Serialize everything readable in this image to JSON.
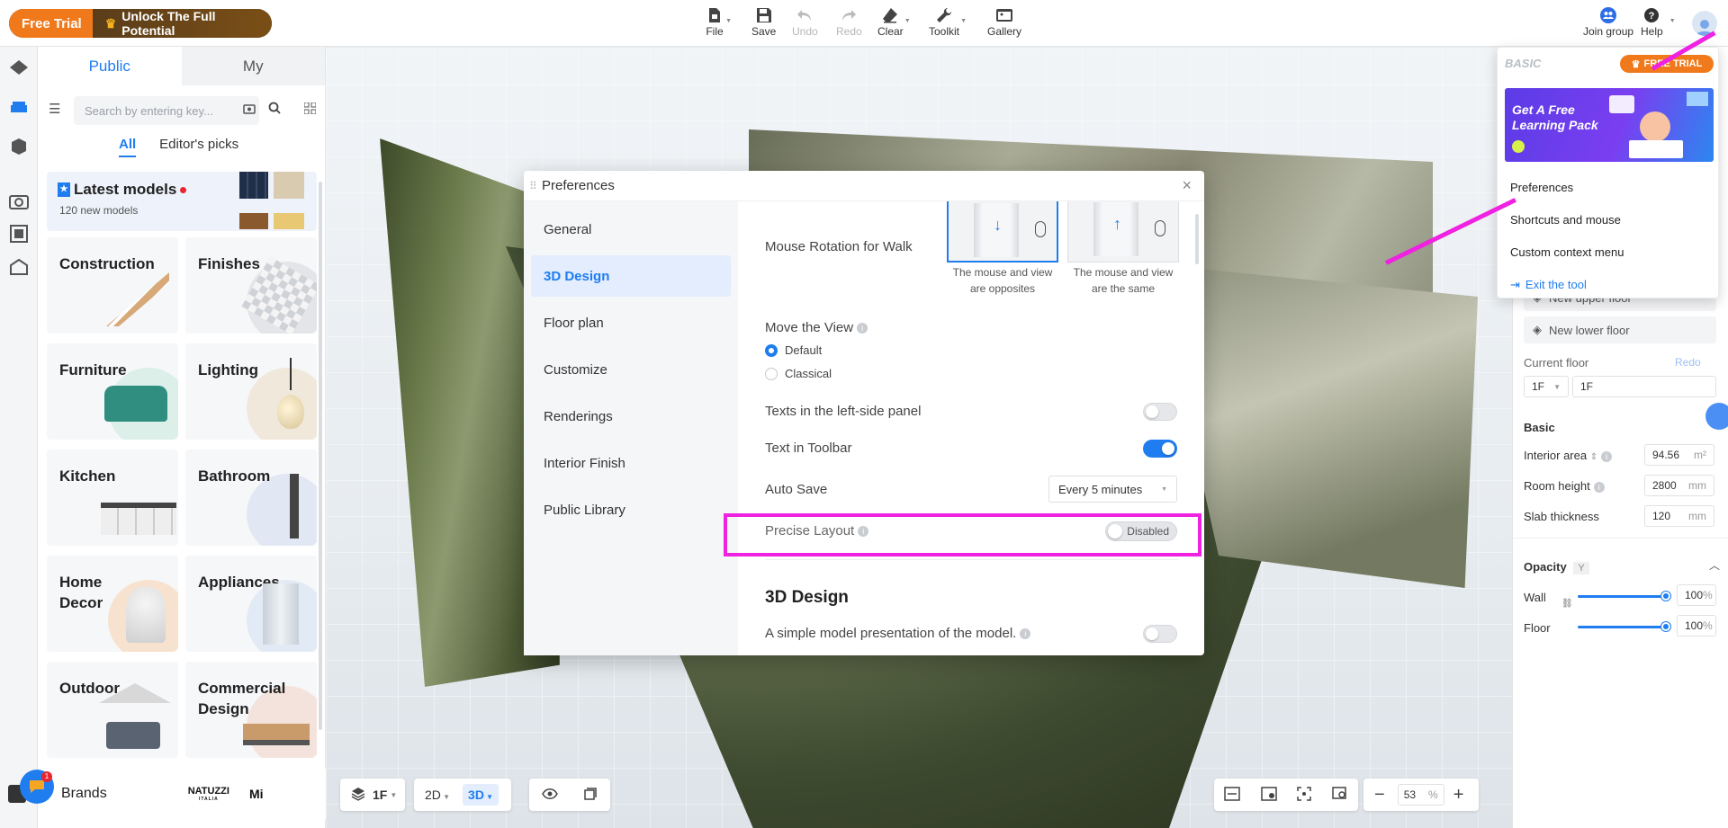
{
  "topbar": {
    "free_trial": "Free Trial",
    "unlock": "Unlock The Full Potential",
    "tools": [
      {
        "label": "File",
        "icon": "file-icon",
        "enabled": true
      },
      {
        "label": "Save",
        "icon": "save-icon",
        "enabled": true
      },
      {
        "label": "Undo",
        "icon": "undo-icon",
        "enabled": false
      },
      {
        "label": "Redo",
        "icon": "redo-icon",
        "enabled": false
      },
      {
        "label": "Clear",
        "icon": "eraser-icon",
        "enabled": true
      },
      {
        "label": "Toolkit",
        "icon": "wrench-icon",
        "enabled": true
      },
      {
        "label": "Gallery",
        "icon": "gallery-icon",
        "enabled": true
      }
    ],
    "join_group": "Join group",
    "help": "Help"
  },
  "library": {
    "tab_public": "Public",
    "tab_my": "My",
    "search_placeholder": "Search by entering key...",
    "sub_all": "All",
    "sub_editors": "Editor's picks",
    "latest_title": "Latest models",
    "latest_sub": "120 new models",
    "categories": [
      "Construction",
      "Finishes",
      "Furniture",
      "Lighting",
      "Kitchen",
      "Bathroom",
      "Home Decor",
      "Appliances",
      "Outdoor",
      "Commercial Design"
    ],
    "brands": "Brands",
    "brand_logo": "NATUZZI",
    "brand_logo_sub": "ITALIA",
    "brand_next": "Mi",
    "badge_count": "1"
  },
  "bottom": {
    "floor": "1F",
    "mode_2d": "2D",
    "mode_3d": "3D",
    "zoom": "53",
    "zoom_unit": "%"
  },
  "dropdown": {
    "plan": "BASIC",
    "free_trial": "FREE TRIAL",
    "banner_line1": "Get A Free",
    "banner_line2": "Learning Pack",
    "items": [
      "Preferences",
      "Shortcuts and mouse",
      "Custom context menu"
    ],
    "exit": "Exit the tool"
  },
  "rightpanel": {
    "new_upper": "New upper floor",
    "new_lower": "New lower floor",
    "current_floor": "Current floor",
    "redo": "Redo",
    "floor_sel": "1F",
    "floor_name": "1F",
    "basic": "Basic",
    "interior_area": "Interior area",
    "interior_val": "94.56",
    "interior_unit": "m²",
    "room_height": "Room height",
    "room_val": "2800",
    "room_unit": "mm",
    "slab": "Slab thickness",
    "slab_val": "120",
    "slab_unit": "mm",
    "opacity": "Opacity",
    "opacity_key": "Y",
    "wall": "Wall",
    "wall_val": "100",
    "floor": "Floor",
    "floor_val": "100",
    "pct": "%",
    "wall_opacity": 1.0,
    "floor_opacity": 1.0
  },
  "modal": {
    "title": "Preferences",
    "nav": [
      "General",
      "3D Design",
      "Floor plan",
      "Customize",
      "Renderings",
      "Interior Finish",
      "Public Library"
    ],
    "active_nav": "3D Design",
    "mouse_rotation": "Mouse Rotation for Walk",
    "opt1_caption_1": "The mouse and view",
    "opt1_caption_2": "are opposites",
    "opt2_caption_1": "The mouse and view",
    "opt2_caption_2": "are the same",
    "move_view": "Move the View",
    "radio_default": "Default",
    "radio_classical": "Classical",
    "texts_left": "Texts in the left-side panel",
    "texts_left_on": false,
    "text_toolbar": "Text in Toolbar",
    "text_toolbar_on": true,
    "auto_save": "Auto Save",
    "auto_save_val": "Every 5 minutes",
    "precise": "Precise Layout",
    "precise_val": "Disabled",
    "section": "3D Design",
    "simple_model": "A simple model presentation of the model.",
    "simple_model_on": false
  },
  "colors": {
    "accent": "#1f7df0",
    "highlight": "#ee22e0",
    "trial": "#f07a1b"
  }
}
